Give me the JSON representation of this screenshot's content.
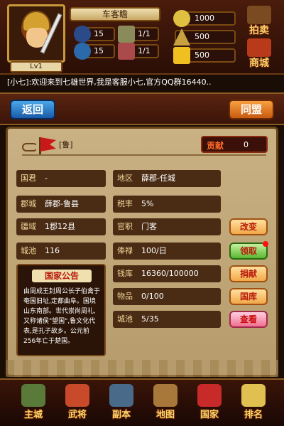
{
  "player": {
    "level": "Lv1",
    "name": "车客瞻"
  },
  "stats": {
    "attack": "15",
    "defense": "15",
    "troops": "1/1",
    "generals": "1/1"
  },
  "resources": {
    "coins": "1000",
    "grain": "500",
    "gold": "500"
  },
  "side_buttons": {
    "auction": "拍卖",
    "shop": "商城"
  },
  "ticker": "[小七]:欢迎来到七雄世界,我是客服小七,官方QQ群16440..",
  "nav": {
    "back": "返回",
    "alliance": "同盟"
  },
  "state": {
    "tag": "[鲁]",
    "contribution_label": "贡献",
    "contribution_value": "0",
    "fields": {
      "monarch_label": "国君",
      "monarch_value": "-",
      "region_label": "地区",
      "region_value": "薛郡-任城",
      "capital_label": "郡城",
      "capital_value": "薛郡-鲁县",
      "tax_label": "税率",
      "tax_value": "5%",
      "territory_label": "疆域",
      "territory_value": "1郡12县",
      "post_label": "官职",
      "post_value": "门客",
      "cities_label": "城池",
      "cities_value": "116",
      "salary_label": "俸禄",
      "salary_value": "100/日",
      "treasury_label": "钱库",
      "treasury_value": "16360/100000",
      "goods_label": "物品",
      "goods_value": "0/100",
      "citypool_label": "城池",
      "citypool_value": "5/35"
    },
    "buttons": {
      "change": "改变",
      "claim": "领取",
      "donate": "捐献",
      "vault": "国库",
      "view": "查看"
    },
    "notice": {
      "title": "国家公告",
      "body": "由周成王封周公长子伯禽于奄国旧址,定都曲阜。国境山东南部。世代崇尚周礼,又称诸侯\"望国\",鲁文化代表,是孔子故乡。公元前256年亡于楚国。"
    }
  },
  "bottom_nav": {
    "city": "主城",
    "generals": "武将",
    "dungeon": "副本",
    "map": "地图",
    "nation": "国家",
    "ranking": "排名"
  }
}
